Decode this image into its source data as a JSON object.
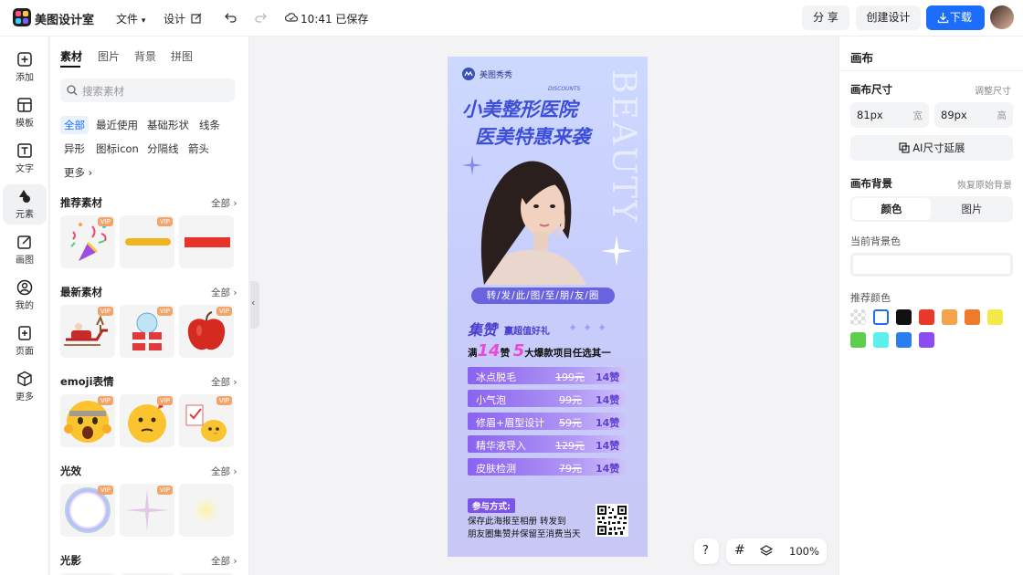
{
  "app": {
    "title": "美图设计室"
  },
  "menu": {
    "file": "文件",
    "design": "设计",
    "saved": "10:41 已保存"
  },
  "toolbar": {
    "share": "分 享",
    "create": "创建设计",
    "download": "下载"
  },
  "rail": [
    {
      "label": "添加",
      "icon": "plus-square-icon"
    },
    {
      "label": "模板",
      "icon": "template-icon"
    },
    {
      "label": "文字",
      "icon": "text-icon"
    },
    {
      "label": "元素",
      "icon": "elements-icon"
    },
    {
      "label": "画图",
      "icon": "draw-icon"
    },
    {
      "label": "我的",
      "icon": "user-icon"
    },
    {
      "label": "页面",
      "icon": "page-add-icon"
    },
    {
      "label": "更多",
      "icon": "cube-icon"
    }
  ],
  "panel": {
    "tabs": [
      "素材",
      "图片",
      "背景",
      "拼图"
    ],
    "search_placeholder": "搜索素材",
    "chips": [
      "全部",
      "最近使用",
      "基础形状",
      "线条",
      "异形",
      "图标icon",
      "分隔线",
      "箭头",
      "更多"
    ],
    "all_label": "全部",
    "vip": "VIP",
    "sections": [
      "推荐素材",
      "最新素材",
      "emoji表情",
      "光效",
      "光影"
    ]
  },
  "poster": {
    "brand": "美图秀秀",
    "discounts": "DISCOUNTS",
    "beauty": "BEAUTY",
    "title1": "小美整形医院",
    "title2": "医美特惠来袭",
    "share_banner": "转/发/此/图/至/朋/友/圈",
    "collect": "集赞",
    "collect_sub": "赢超值好礼",
    "full_pre": "满",
    "full_num": "14",
    "full_mid": "赞",
    "full_num2": "5",
    "full_post": "大爆款项目任选其一",
    "items": [
      {
        "name": "冰点脱毛",
        "price": "199元",
        "likes": "14赞"
      },
      {
        "name": "小气泡",
        "price": "99元",
        "likes": "14赞"
      },
      {
        "name": "修眉+眉型设计",
        "price": "59元",
        "likes": "14赞"
      },
      {
        "name": "精华液导入",
        "price": "129元",
        "likes": "14赞"
      },
      {
        "name": "皮肤检测",
        "price": "79元",
        "likes": "14赞"
      }
    ],
    "join_title": "参与方式:",
    "join_line1": "保存此海报至相册  转发到",
    "join_line2": "朋友圈集赞并保留至消费当天"
  },
  "bottom": {
    "help": "?",
    "zoom": "100%"
  },
  "right": {
    "title": "画布",
    "size_label": "画布尺寸",
    "size_adjust": "调整尺寸",
    "width_value": "81px",
    "width_unit": "宽",
    "height_value": "89px",
    "height_unit": "高",
    "ai_extend": "AI尺寸延展",
    "bg_label": "画布背景",
    "bg_reset": "恢复原始背景",
    "seg_color": "颜色",
    "seg_image": "图片",
    "current_bg": "当前背景色",
    "rec_colors": "推荐颜色",
    "swatches": [
      "transparent",
      "#ffffff",
      "#111111",
      "#e8392a",
      "#f5a34a",
      "#ee7a2a",
      "#f5e94a",
      "#5ccf4f",
      "#5ef0ea",
      "#2b7ef0",
      "#8a4ef0"
    ]
  }
}
